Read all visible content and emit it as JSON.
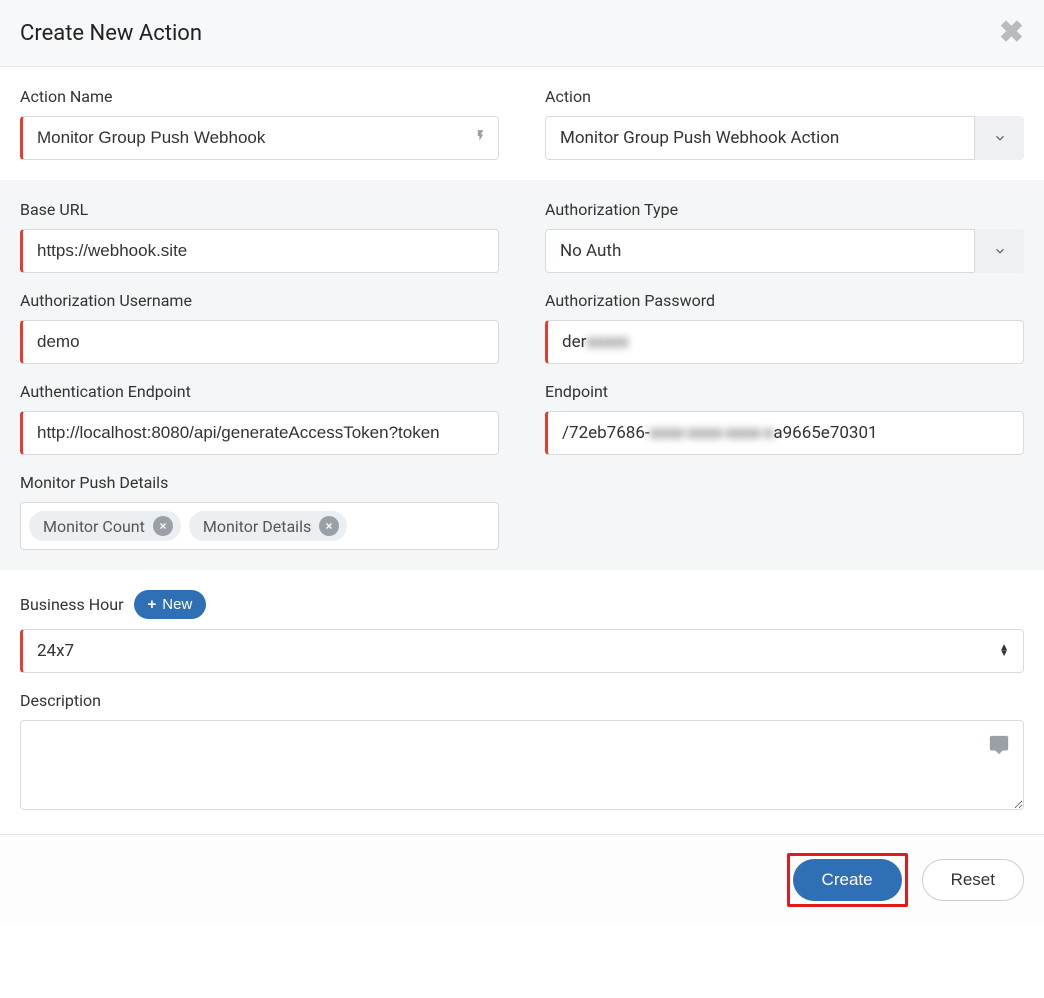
{
  "header": {
    "title": "Create New Action"
  },
  "form": {
    "action_name": {
      "label": "Action Name",
      "value": "Monitor Group Push Webhook"
    },
    "action_type": {
      "label": "Action",
      "value": "Monitor Group Push Webhook Action"
    },
    "base_url": {
      "label": "Base URL",
      "value": "https://webhook.site"
    },
    "auth_type": {
      "label": "Authorization Type",
      "value": "No Auth"
    },
    "auth_username": {
      "label": "Authorization Username",
      "value": "demo"
    },
    "auth_password": {
      "label": "Authorization Password",
      "value": "der",
      "masked_tail": "xxxxx"
    },
    "auth_endpoint": {
      "label": "Authentication Endpoint",
      "value": "http://localhost:8080/api/generateAccessToken?token"
    },
    "endpoint": {
      "label": "Endpoint",
      "prefix": "/72eb7686-",
      "masked": "xxxx-xxxx-xxxx-x",
      "suffix": "a9665e70301"
    },
    "monitor_push_details": {
      "label": "Monitor Push Details",
      "tags": [
        "Monitor Count",
        "Monitor Details"
      ]
    },
    "business_hour": {
      "label": "Business Hour",
      "new_label": "New",
      "value": "24x7"
    },
    "description": {
      "label": "Description",
      "value": ""
    }
  },
  "footer": {
    "create_label": "Create",
    "reset_label": "Reset"
  }
}
